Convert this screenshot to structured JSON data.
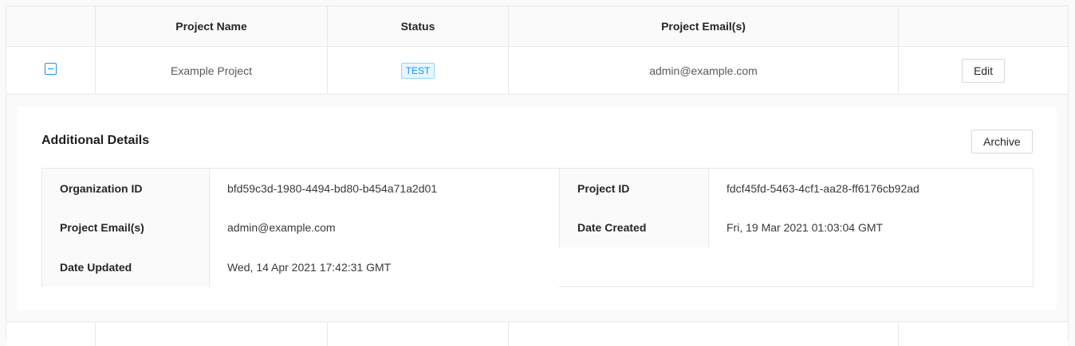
{
  "table": {
    "columns": [
      "",
      "Project Name",
      "Status",
      "Project Email(s)",
      ""
    ],
    "rows": [
      {
        "name": "Example Project",
        "status": "TEST",
        "email": "admin@example.com",
        "edit_label": "Edit"
      }
    ]
  },
  "details": {
    "title": "Additional Details",
    "archive_label": "Archive",
    "fields": {
      "org_id_label": "Organization ID",
      "org_id_value": "bfd59c3d-1980-4494-bd80-b454a71a2d01",
      "project_id_label": "Project ID",
      "project_id_value": "fdcf45fd-5463-4cf1-aa28-ff6176cb92ad",
      "emails_label": "Project Email(s)",
      "emails_value": "admin@example.com",
      "created_label": "Date Created",
      "created_value": "Fri, 19 Mar 2021 01:03:04 GMT",
      "updated_label": "Date Updated",
      "updated_value": "Wed, 14 Apr 2021 17:42:31 GMT"
    }
  },
  "colors": {
    "primary": "#1890ff",
    "tag_bg": "#e6f7ff",
    "border": "#e8e8e8"
  }
}
